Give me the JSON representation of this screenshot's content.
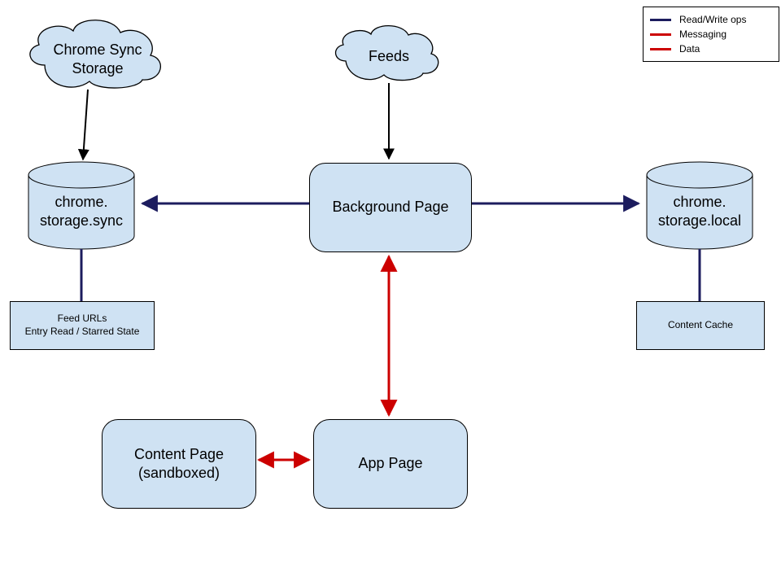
{
  "legend": {
    "readwrite": "Read/Write ops",
    "messaging": "Messaging",
    "data": "Data"
  },
  "clouds": {
    "sync": "Chrome Sync\nStorage",
    "feeds": "Feeds"
  },
  "dbs": {
    "sync": "chrome.\nstorage.sync",
    "local": "chrome.\nstorage.local"
  },
  "boxes": {
    "background": "Background Page",
    "app": "App Page",
    "content": "Content Page\n(sandboxed)",
    "feedurls": "Feed URLs\nEntry Read / Starred State",
    "cache": "Content Cache"
  },
  "colors": {
    "fill": "#cfe2f3",
    "edge_rw": "#1c1c5e",
    "edge_msg": "#cc0000"
  }
}
